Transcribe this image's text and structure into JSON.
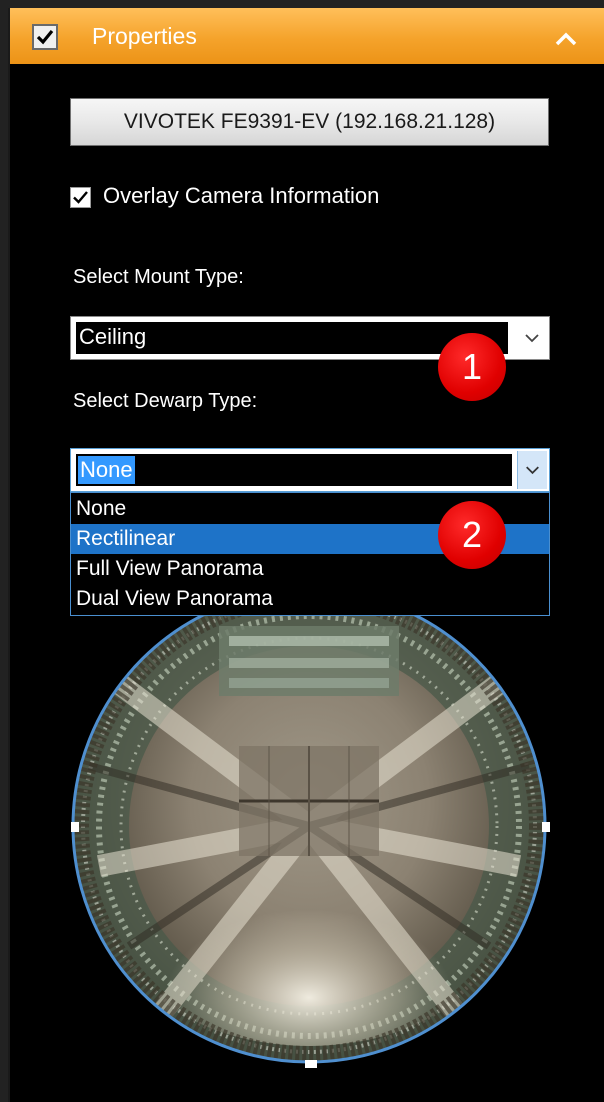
{
  "panel": {
    "title": "Properties",
    "enabled": true,
    "collapse_icon": "chevron-up-icon",
    "accent_color": "#f5a32b"
  },
  "camera_button": {
    "label": "VIVOTEK FE9391-EV (192.168.21.128)"
  },
  "overlay": {
    "label": "Overlay Camera Information",
    "checked": true
  },
  "mount": {
    "label": "Select Mount Type:",
    "value": "Ceiling"
  },
  "dewarp": {
    "label": "Select Dewarp Type:",
    "value": "None",
    "options": [
      "None",
      "Rectilinear",
      "Full View Panorama",
      "Dual View Panorama"
    ],
    "highlighted_option": "Rectilinear"
  },
  "annotations": [
    "1",
    "2"
  ],
  "preview": {
    "icon": "fisheye-camera-view"
  }
}
